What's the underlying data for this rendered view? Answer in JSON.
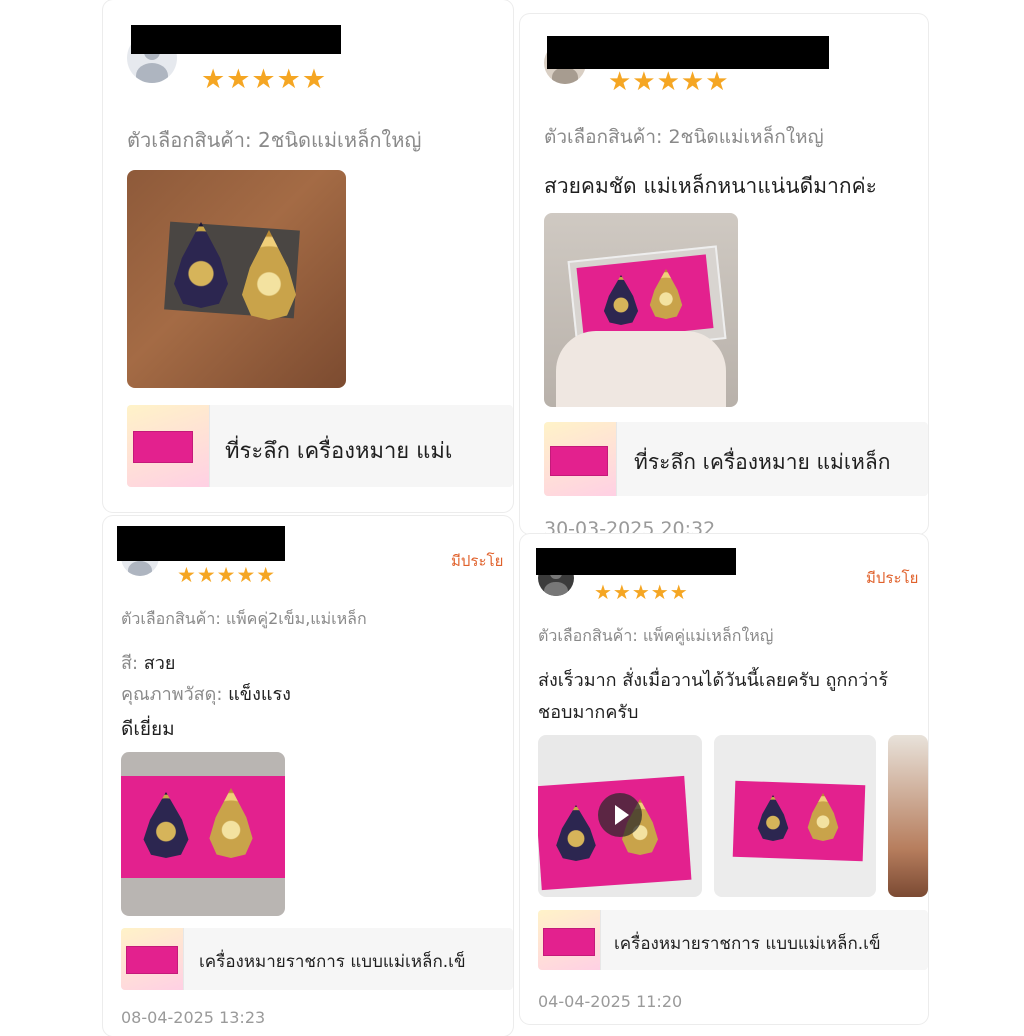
{
  "reviews": [
    {
      "stars": "★★★★★",
      "variant": "ตัวเลือกสินค้า: 2ชนิดแม่เหล็กใหญ่",
      "product_name": "ที่ระลึก เครื่องหมาย แม่เ"
    },
    {
      "stars": "★★★★★",
      "variant": "ตัวเลือกสินค้า: 2ชนิดแม่เหล็กใหญ่",
      "text": "สวยคมชัด แม่เหล็กหนาแน่นดีมากค่ะ",
      "product_name": "ที่ระลึก เครื่องหมาย แม่เหล็ก",
      "datetime": "30-03-2025 20:32"
    },
    {
      "stars": "★★★★★",
      "helpful": "มีประโย",
      "variant": "ตัวเลือกสินค้า: แพ็คคู่2เข็ม,แม่เหล็ก",
      "color_label": "สี:",
      "color_value": "สวย",
      "quality_label": "คุณภาพวัสดุ:",
      "quality_value": "แข็งแรง",
      "text": "ดีเยี่ยม",
      "product_name": "เครื่องหมายราชการ แบบแม่เหล็ก.เข็",
      "datetime": "08-04-2025 13:23"
    },
    {
      "stars": "★★★★★",
      "helpful": "มีประโย",
      "variant": "ตัวเลือกสินค้า: แพ็คคู่แม่เหล็กใหญ่",
      "text_line1": "ส่งเร็วมาก สั่งเมื่อวานได้วันนี้เลยครับ ถูกกว่าร้",
      "text_line2": "ชอบมากครับ",
      "product_name": "เครื่องหมายราชการ แบบแม่เหล็ก.เข็",
      "datetime": "04-04-2025 11:20"
    }
  ]
}
